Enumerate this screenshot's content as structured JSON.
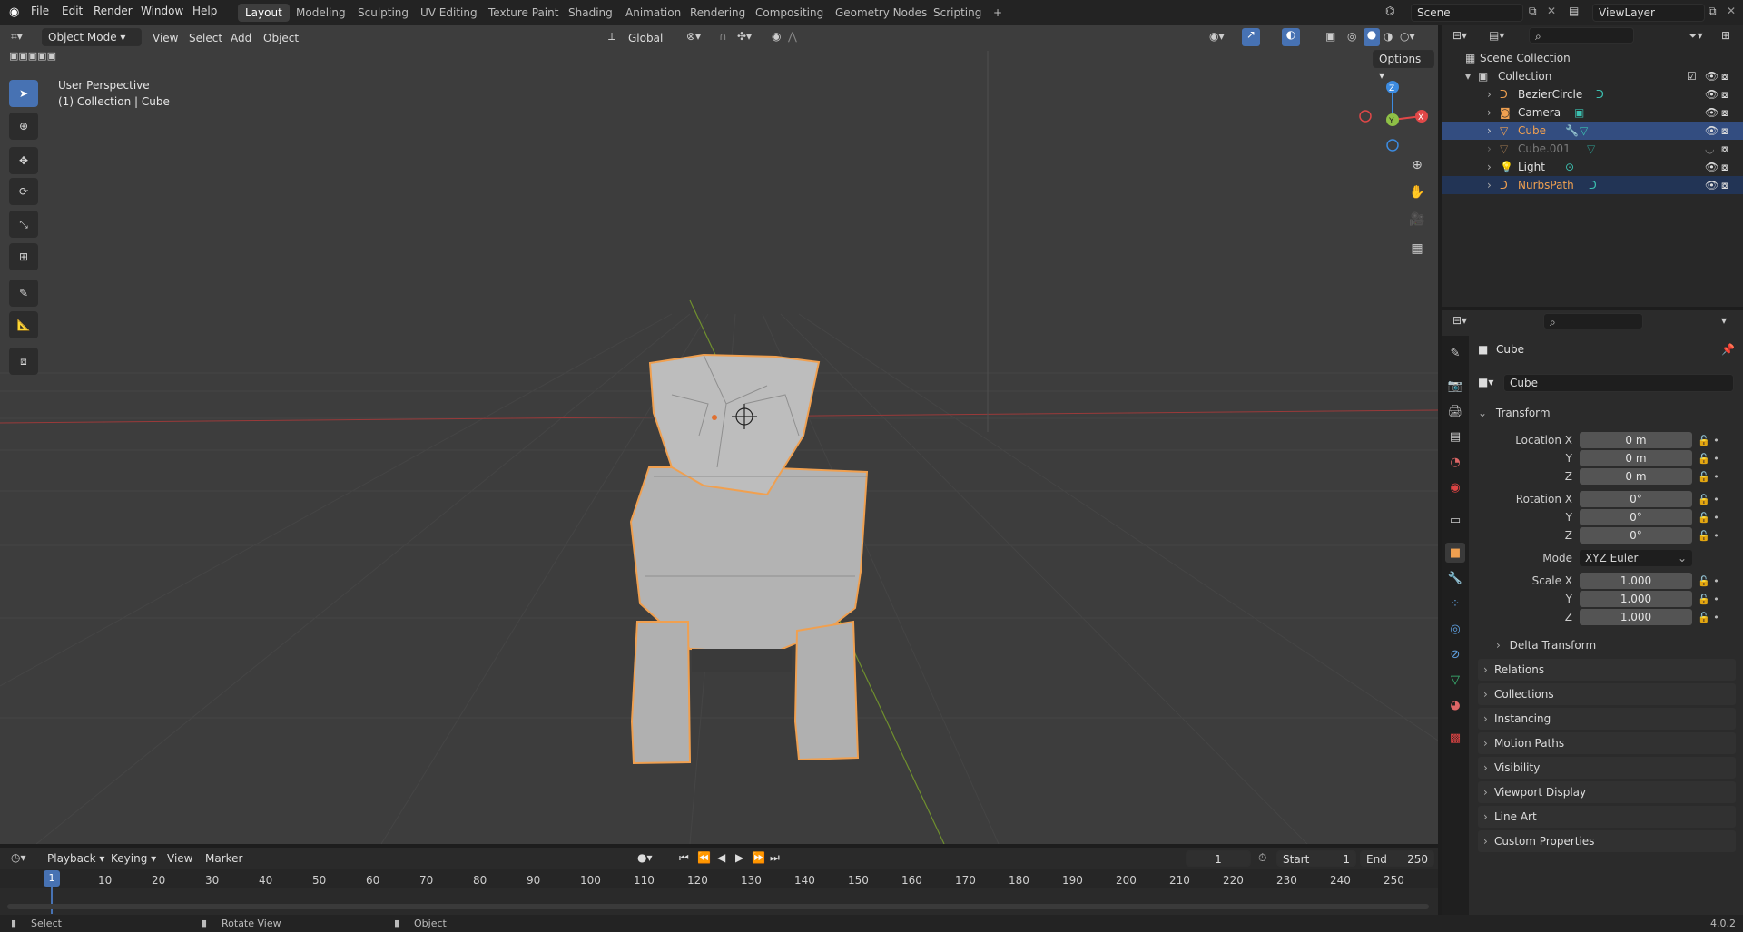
{
  "topbar": {
    "menu": [
      "File",
      "Edit",
      "Render",
      "Window",
      "Help"
    ],
    "workspaces": [
      "Layout",
      "Modeling",
      "Sculpting",
      "UV Editing",
      "Texture Paint",
      "Shading",
      "Animation",
      "Rendering",
      "Compositing",
      "Geometry Nodes",
      "Scripting"
    ],
    "add_tab": "+",
    "scene": "Scene",
    "view_layer": "ViewLayer"
  },
  "viewport_header": {
    "mode": "Object Mode",
    "menus": [
      "View",
      "Select",
      "Add",
      "Object"
    ],
    "orientation": "Global",
    "options": "Options"
  },
  "viewport": {
    "perspective": "User Perspective",
    "collection_info": "(1) Collection | Cube",
    "gizmo": {
      "x": "X",
      "y": "Y",
      "z": "Z"
    }
  },
  "outliner": {
    "scene_collection": "Scene Collection",
    "collection": "Collection",
    "items": [
      {
        "name": "BezierCircle",
        "color": "#e0e0e0"
      },
      {
        "name": "Camera",
        "color": "#e0e0e0"
      },
      {
        "name": "Cube",
        "color": "#f0a050"
      },
      {
        "name": "Cube.001",
        "color": "#7a7a7a"
      },
      {
        "name": "Light",
        "color": "#e0e0e0"
      },
      {
        "name": "NurbsPath",
        "color": "#f0a050"
      }
    ]
  },
  "properties": {
    "object_name": "Cube",
    "datablock_name": "Cube",
    "transform_label": "Transform",
    "location": {
      "label": "Location X",
      "x": "0 m",
      "y": "0 m",
      "z": "0 m"
    },
    "rotation": {
      "label": "Rotation X",
      "x": "0°",
      "y": "0°",
      "z": "0°"
    },
    "mode_label": "Mode",
    "mode_value": "XYZ Euler",
    "scale": {
      "label": "Scale X",
      "x": "1.000",
      "y": "1.000",
      "z": "1.000"
    },
    "axis_y": "Y",
    "axis_z": "Z",
    "delta_transform": "Delta Transform",
    "panels": [
      "Relations",
      "Collections",
      "Instancing",
      "Motion Paths",
      "Visibility",
      "Viewport Display",
      "Line Art",
      "Custom Properties"
    ]
  },
  "timeline": {
    "menus": [
      "Playback",
      "Keying",
      "View",
      "Marker"
    ],
    "current_frame": "1",
    "start_label": "Start",
    "start_value": "1",
    "end_label": "End",
    "end_value": "250",
    "ticks": [
      "10",
      "20",
      "30",
      "40",
      "50",
      "60",
      "70",
      "80",
      "90",
      "100",
      "110",
      "120",
      "130",
      "140",
      "150",
      "160",
      "170",
      "180",
      "190",
      "200",
      "210",
      "220",
      "230",
      "240",
      "250"
    ],
    "playhead": "1"
  },
  "statusbar": {
    "select": "Select",
    "rotate": "Rotate View",
    "object": "Object",
    "version": "4.0.2"
  },
  "colors": {
    "accent": "#4772b3",
    "selection": "#f0a050",
    "x_axis": "#e04848",
    "y_axis": "#8ec046",
    "z_axis": "#3c8be0"
  }
}
